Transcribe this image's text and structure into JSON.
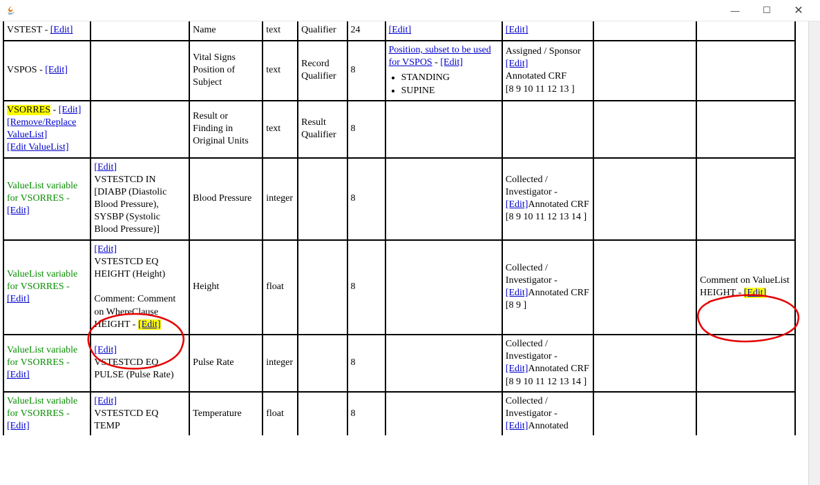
{
  "window": {
    "minimize": "—",
    "maximize": "☐",
    "close": "✕"
  },
  "linkEdit": "[Edit]",
  "linkRemoveReplace": "[Remove/Replace ValueList]",
  "linkEditValueList": "[Edit ValueList]",
  "valueListPrefix": "ValueList variable for VSORRES - ",
  "rows": {
    "r0": {
      "c1": "VSTEST - ",
      "c3": "Name",
      "c4": "text",
      "c5": "Qualifier",
      "c6": "24"
    },
    "r1": {
      "c1": "VSPOS - ",
      "c3": "Vital Signs Position of Subject",
      "c4": "text",
      "c5": "Record Qualifier",
      "c6": "8",
      "c7a": "Position, subset to be used for VSPOS",
      "c7b1": "STANDING",
      "c7b2": "SUPINE",
      "c8a": "Assigned / Sponsor",
      "c8b": "Annotated CRF",
      "c8c": "[8 9 10 11 12 13 ]"
    },
    "r2": {
      "c1a": "VSORRES",
      "c3": "Result or Finding in Original Units",
      "c4": "text",
      "c5": "Result Qualifier",
      "c6": "8"
    },
    "r3": {
      "c2": "VSTESTCD IN [DIABP (Diastolic Blood Pressure), SYSBP (Systolic Blood Pressure)]",
      "c3": "Blood Pressure",
      "c4": "integer",
      "c6": "8",
      "c8a": "Collected / Investigator - ",
      "c8b": "Annotated CRF",
      "c8c": "[8 9 10 11 12 13 14 ]"
    },
    "r4": {
      "c2a": "VSTESTCD EQ HEIGHT (Height)",
      "c2b": "Comment: Comment on WhereClause HEIGHT - ",
      "c3": "Height",
      "c4": "float",
      "c6": "8",
      "c8a": "Collected / Investigator - ",
      "c8b": "Annotated CRF",
      "c8c": "[8 9 ]",
      "c10": "Comment on ValueList HEIGHT - "
    },
    "r5": {
      "c2": "VSTESTCD EQ PULSE (Pulse Rate)",
      "c3": "Pulse Rate",
      "c4": "integer",
      "c6": "8",
      "c8a": "Collected / Investigator - ",
      "c8b": "Annotated CRF",
      "c8c": "[8 9 10 11 12 13 14 ]"
    },
    "r6": {
      "c2": "VSTESTCD EQ TEMP",
      "c3": "Temperature",
      "c4": "float",
      "c6": "8",
      "c8a": "Collected / Investigator - ",
      "c8b": "Annotated"
    }
  }
}
